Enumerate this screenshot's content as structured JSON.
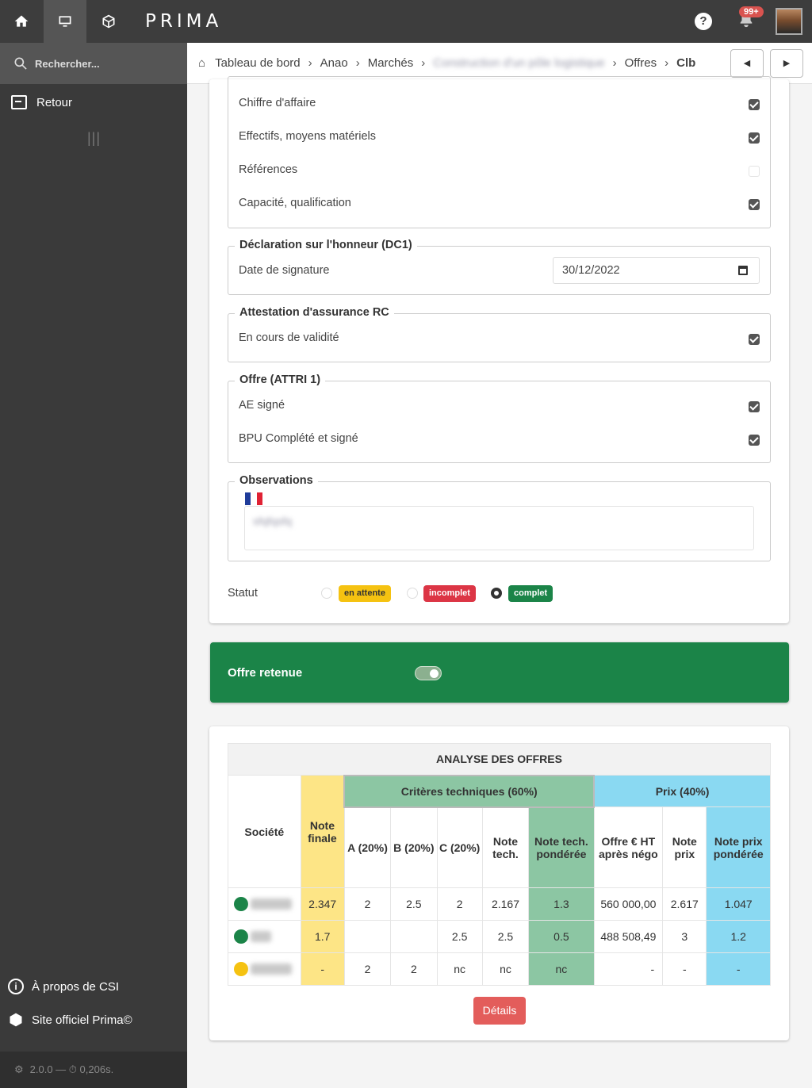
{
  "app": {
    "logo": "PRIMA",
    "notif_badge": "99+"
  },
  "sidebar": {
    "search_label": "Rechercher...",
    "retour": "Retour",
    "about": "À propos de CSI",
    "site": "Site officiel Prima©",
    "footer": "2.0.0 — ⏱ 0,206s."
  },
  "breadcrumb": {
    "items": [
      "Tableau de bord",
      "Anao",
      "Marchés",
      "Construction d'un pôle logistique",
      "Offres",
      "Clb"
    ],
    "prev": "◀",
    "next": "▶"
  },
  "capacites": {
    "items": [
      {
        "label": "Chiffre d'affaire",
        "checked": true
      },
      {
        "label": "Effectifs, moyens matériels",
        "checked": true
      },
      {
        "label": "Références",
        "checked": false
      },
      {
        "label": "Capacité, qualification",
        "checked": true
      }
    ]
  },
  "dc1": {
    "legend": "Déclaration sur l'honneur (DC1)",
    "date_label": "Date de signature",
    "date_value": "30/12/2022"
  },
  "assurance": {
    "legend": "Attestation d'assurance RC",
    "label": "En cours de validité",
    "checked": true
  },
  "offre": {
    "legend": "Offre (ATTRI 1)",
    "items": [
      {
        "label": "AE signé",
        "checked": true
      },
      {
        "label": "BPU Complété et signé",
        "checked": true
      }
    ]
  },
  "observations": {
    "legend": "Observations",
    "text": "sfqfqsfq"
  },
  "statut": {
    "label": "Statut",
    "options": [
      {
        "label": "en attente",
        "selected": false,
        "color": "#f5c211"
      },
      {
        "label": "incomplet",
        "selected": false,
        "color": "#dc3545"
      },
      {
        "label": "complet",
        "selected": true,
        "color": "#1b8448"
      }
    ]
  },
  "retenue": {
    "label": "Offre retenue",
    "on": true
  },
  "analyse": {
    "title": "ANALYSE DES OFFRES",
    "group_tech": "Critères techniques (60%)",
    "group_prix": "Prix (40%)",
    "headers": {
      "societe": "Société",
      "note_finale": "Note finale",
      "a": "A (20%)",
      "b": "B (20%)",
      "c": "C (20%)",
      "note_tech": "Note tech.",
      "note_tech_pond": "Note tech. pondérée",
      "offre_ht": "Offre € HT après négo",
      "note_prix": "Note prix",
      "note_prix_pond": "Note prix pondérée"
    },
    "rows": [
      {
        "dot": "#1b8448",
        "finale": "2.347",
        "a": "2",
        "b": "2.5",
        "c": "2",
        "tech": "2.167",
        "tech_p": "1.3",
        "offre": "560 000,00",
        "prix": "2.617",
        "prix_p": "1.047"
      },
      {
        "dot": "#1b8448",
        "finale": "1.7",
        "a": "",
        "b": "",
        "c": "2.5",
        "tech": "2.5",
        "tech_p": "0.5",
        "offre": "488 508,49",
        "prix": "3",
        "prix_p": "1.2"
      },
      {
        "dot": "#f5c211",
        "finale": "-",
        "a": "2",
        "b": "2",
        "c": "nc",
        "tech": "nc",
        "tech_p": "nc",
        "offre": "-",
        "prix": "-",
        "prix_p": "-"
      }
    ],
    "details_button": "Détails"
  }
}
